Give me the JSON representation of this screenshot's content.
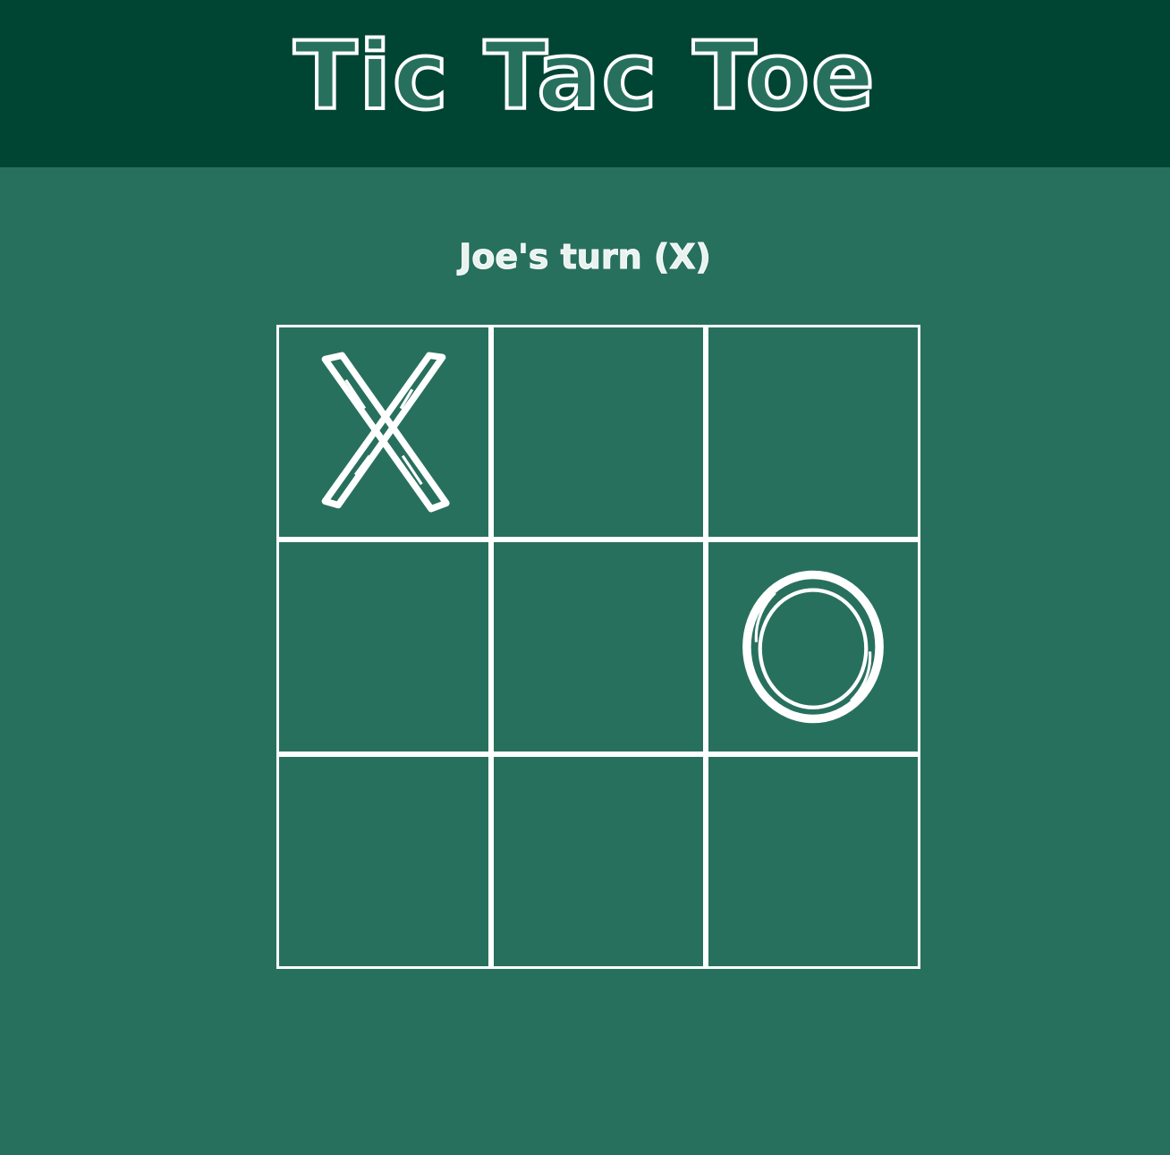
{
  "header": {
    "title": "Tic Tac Toe"
  },
  "status": {
    "text": "Joe's turn (X)"
  },
  "board": {
    "cells": [
      "X",
      "",
      "",
      "",
      "",
      "O",
      "",
      "",
      ""
    ]
  },
  "colors": {
    "header_bg": "#004433",
    "board_bg": "#28705e",
    "chalk": "#ffffff"
  }
}
